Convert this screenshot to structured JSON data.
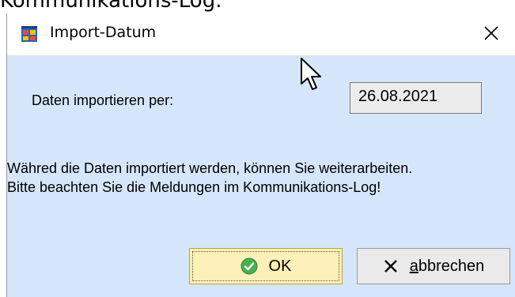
{
  "background": {
    "partial_text": "Kommunikations-Log."
  },
  "window": {
    "title": "Import-Datum",
    "close_glyph": "✕"
  },
  "form": {
    "date_label": "Daten importieren per:",
    "date_value": "26.08.2021"
  },
  "info": {
    "line1": "Währed die Daten importiert werden, können Sie weiterarbeiten.",
    "line2": "Bitte beachten Sie die Meldungen im Kommunikations-Log!"
  },
  "buttons": {
    "ok_label": "OK",
    "cancel_mnemonic": "a",
    "cancel_rest": "bbrechen"
  },
  "icons": {
    "app": "application-window-icon",
    "ok": "check-circle-icon",
    "cancel": "x-icon",
    "close": "close-icon",
    "cursor": "mouse-pointer-icon"
  },
  "colors": {
    "dialog_background": "#d6e6fa",
    "ok_background": "#fdf0b8",
    "ok_check": "#4caf50"
  }
}
